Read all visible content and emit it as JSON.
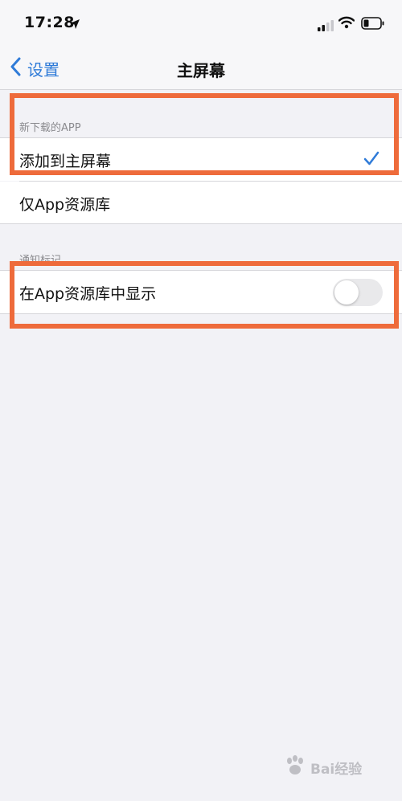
{
  "status_bar": {
    "time": "17:28",
    "icons": [
      "location-arrow-icon",
      "signal-icon",
      "wifi-icon",
      "battery-icon"
    ]
  },
  "nav": {
    "back_label": "设置",
    "title": "主屏幕"
  },
  "sections": {
    "new_downloads": {
      "header": "新下载的APP",
      "options": [
        {
          "label": "添加到主屏幕",
          "selected": true
        },
        {
          "label": "仅App资源库",
          "selected": false
        }
      ]
    },
    "badges": {
      "header": "通知标记",
      "row_label": "在App资源库中显示",
      "toggle_on": false
    }
  },
  "watermark": {
    "text": "Bai经验"
  },
  "colors": {
    "accent": "#2f7bd8",
    "highlight": "#ee6b3b",
    "background": "#f2f2f6"
  }
}
